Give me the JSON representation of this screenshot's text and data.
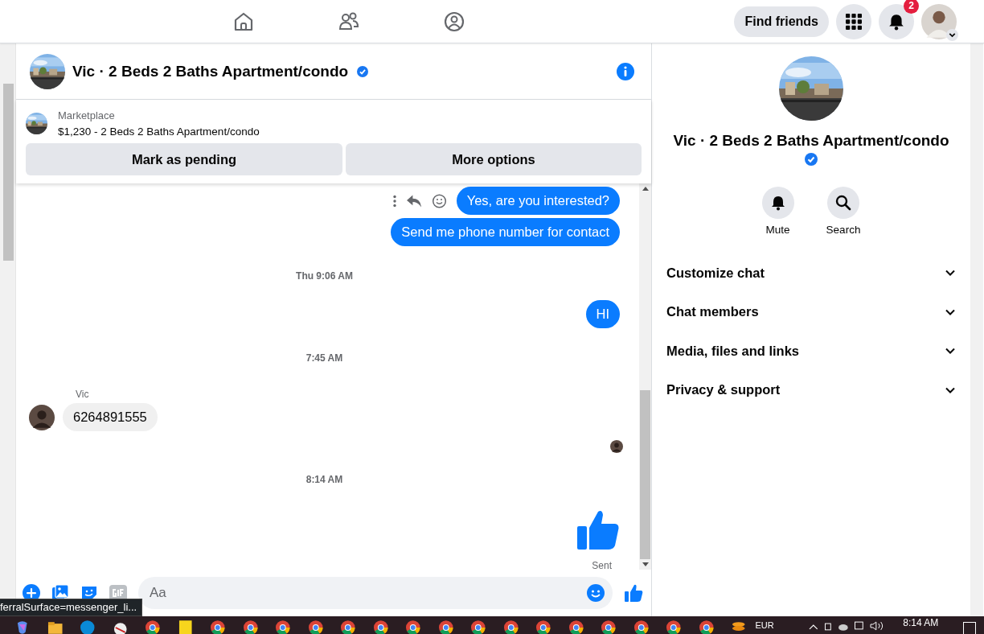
{
  "top_nav": {
    "tabs": [
      {
        "kind": "home",
        "selected": false
      },
      {
        "kind": "friends",
        "selected": false
      },
      {
        "kind": "groups",
        "selected": false
      }
    ],
    "find_friends": "Find friends",
    "notifications_badge": "2"
  },
  "chat": {
    "title": "Vic · 2 Beds 2 Baths Apartment/condo",
    "verified": true,
    "listing": {
      "source": "Marketplace",
      "summary": "$1,230 - 2 Beds 2 Baths Apartment/condo"
    },
    "actions": [
      "Mark as pending",
      "More options"
    ],
    "messages": [
      {
        "kind": "outgoing",
        "text": "Yes, are you interested?",
        "hovered": true
      },
      {
        "kind": "outgoing",
        "text": "Send me phone number for contact",
        "hovered": false
      },
      {
        "kind": "timestamp",
        "text": "Thu 9:06 AM"
      },
      {
        "kind": "outgoing",
        "text": "HI",
        "hovered": false
      },
      {
        "kind": "timestamp",
        "text": "7:45 AM"
      },
      {
        "kind": "incoming",
        "sender": "Vic",
        "text": "6264891555"
      },
      {
        "kind": "seen"
      },
      {
        "kind": "timestamp",
        "text": "8:14 AM"
      },
      {
        "kind": "like",
        "status": "Sent"
      }
    ],
    "composer": {
      "placeholder": "Aa"
    }
  },
  "details": {
    "title": "Vic · 2 Beds 2 Baths Apartment/condo",
    "verified": true,
    "actions": [
      {
        "kind": "mute",
        "label": "Mute"
      },
      {
        "kind": "search",
        "label": "Search"
      }
    ],
    "sections": [
      {
        "label": "Customize chat",
        "expanded": false
      },
      {
        "label": "Chat members",
        "expanded": false
      },
      {
        "label": "Media, files and links",
        "expanded": false
      },
      {
        "label": "Privacy & support",
        "expanded": false
      }
    ]
  },
  "status_url": "ferralSurface=messenger_li...",
  "taskbar": {
    "currency": "EUR",
    "time": "8:14 AM"
  }
}
